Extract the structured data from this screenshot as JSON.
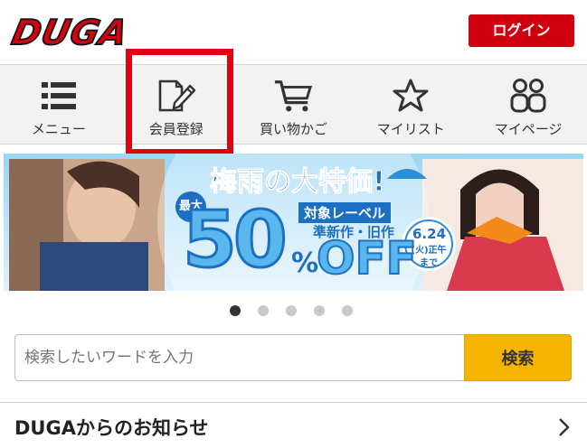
{
  "header": {
    "logo_text": "DUGA",
    "login_label": "ログイン"
  },
  "nav": {
    "items": [
      {
        "label": "メニュー",
        "icon": "menu-list-icon"
      },
      {
        "label": "会員登録",
        "icon": "register-edit-icon"
      },
      {
        "label": "買い物かご",
        "icon": "shopping-cart-icon"
      },
      {
        "label": "マイリスト",
        "icon": "star-icon"
      },
      {
        "label": "マイページ",
        "icon": "users-icon"
      }
    ],
    "highlighted_index": 1
  },
  "banner": {
    "title": "梅雨の大特価!",
    "max_label": "最大",
    "discount": "50",
    "percent": "%",
    "off": "OFF",
    "line1": "対象レーベル",
    "line2": "準新作・旧作",
    "date": "6.24",
    "date_sub": "(火)正午",
    "date_end": "まで"
  },
  "carousel": {
    "dots": 5,
    "active_index": 0
  },
  "search": {
    "placeholder": "検索したいワードを入力",
    "button_label": "検索"
  },
  "notice": {
    "title": "DUGAからのお知らせ"
  },
  "colors": {
    "brand_red": "#cf0010",
    "search_yellow": "#f5b400",
    "highlight_red": "#e00012"
  }
}
